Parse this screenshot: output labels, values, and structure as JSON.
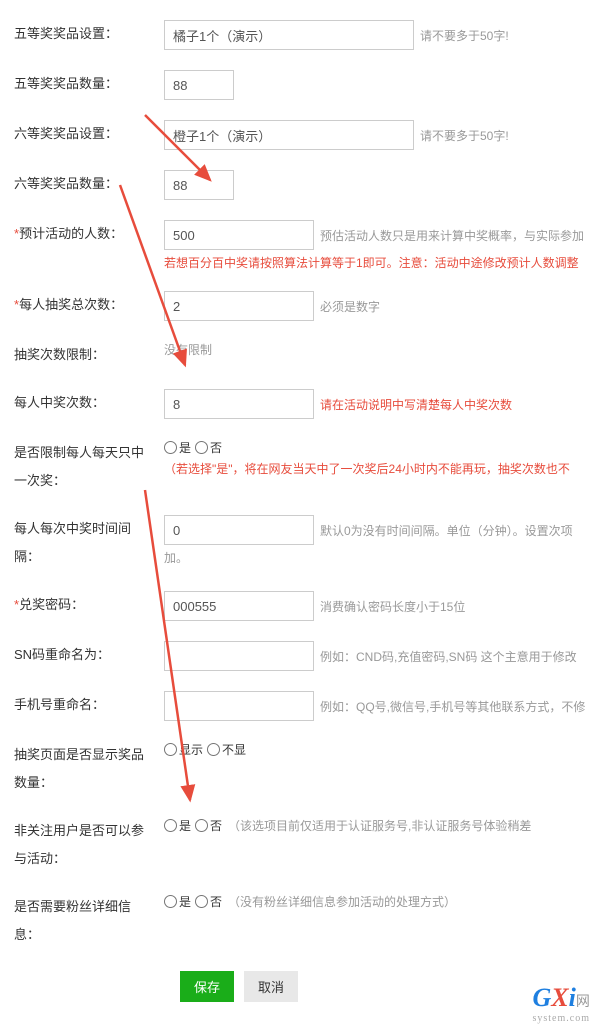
{
  "rows": {
    "prize5_setting": {
      "label": "五等奖奖品设置：",
      "value": "橘子1个（演示）",
      "hint": "请不要多于50字!"
    },
    "prize5_qty": {
      "label": "五等奖奖品数量：",
      "value": "88"
    },
    "prize6_setting": {
      "label": "六等奖奖品设置：",
      "value": "橙子1个（演示）",
      "hint": "请不要多于50字!"
    },
    "prize6_qty": {
      "label": "六等奖奖品数量：",
      "value": "88"
    },
    "expected_people": {
      "label": "预计活动的人数：",
      "req": "*",
      "value": "500",
      "hint": "预估活动人数只是用来计算中奖概率，与实际参加",
      "warn": "若想百分百中奖请按照算法计算等于1即可。注意：活动中途修改预计人数调整"
    },
    "draw_total": {
      "label": "每人抽奖总次数：",
      "req": "*",
      "value": "2",
      "hint": "必须是数字"
    },
    "draw_limit": {
      "label": "抽奖次数限制：",
      "text": "没有限制"
    },
    "win_count": {
      "label": "每人中奖次数：",
      "value": "8",
      "warn": "请在活动说明中写清楚每人中奖次数"
    },
    "daily_limit": {
      "label": "是否限制每人每天只中一次奖：",
      "opt_yes": "是",
      "opt_no": "否",
      "warn": "（若选择\"是\"，将在网友当天中了一次奖后24小时内不能再玩，抽奖次数也不"
    },
    "win_interval": {
      "label": "每人每次中奖时间间隔：",
      "value": "0",
      "hint": "默认0为没有时间间隔。单位（分钟）。设置次项",
      "hint2": "加。"
    },
    "redeem_pwd": {
      "label": "兑奖密码：",
      "req": "*",
      "value": "000555",
      "hint": "消费确认密码长度小于15位"
    },
    "sn_rename": {
      "label": "SN码重命名为：",
      "value": "",
      "hint": "例如：CND码,充值密码,SN码 这个主意用于修改"
    },
    "phone_rename": {
      "label": "手机号重命名：",
      "value": "",
      "hint": "例如：QQ号,微信号,手机号等其他联系方式，不修"
    },
    "show_qty": {
      "label": "抽奖页面是否显示奖品数量：",
      "opt_yes": "显示",
      "opt_no": "不显"
    },
    "nonfollow": {
      "label": "非关注用户是否可以参与活动：",
      "opt_yes": "是",
      "opt_no": "否",
      "hint": "（该选项目前仅适用于认证服务号,非认证服务号体验稍差"
    },
    "need_detail": {
      "label": "是否需要粉丝详细信息：",
      "opt_yes": "是",
      "opt_no": "否",
      "hint": "（没有粉丝详细信息参加活动的处理方式）"
    }
  },
  "buttons": {
    "save": "保存",
    "cancel": "取消"
  },
  "logo": {
    "g": "G",
    "x": "X",
    "i": "i",
    "txt": "网",
    "sub": "system.com"
  }
}
